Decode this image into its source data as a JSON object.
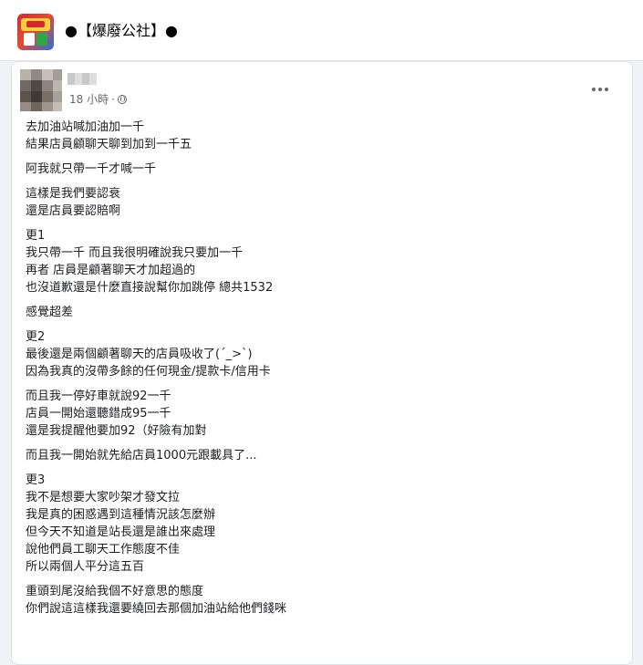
{
  "group": {
    "name": "●【爆廢公社】●"
  },
  "post": {
    "time": "18 小時",
    "separator": "·",
    "paragraphs": [
      [
        "去加油站喊加油加一千",
        "結果店員顧聊天聊到加到一千五"
      ],
      [
        "阿我就只帶一千才喊一千"
      ],
      [
        "這樣是我們要認衰",
        "還是店員要認賠啊"
      ],
      [
        "更1",
        "我只帶一千 而且我很明確說我只要加一千",
        "再者 店員是顧著聊天才加超過的",
        "也沒道歉還是什麼直接說幫你加跳停 總共1532"
      ],
      [
        "感覺超差"
      ],
      [
        "更2",
        "最後還是兩個顧著聊天的店員吸收了(´_>`)",
        "因為我真的沒帶多餘的任何現金/提款卡/信用卡"
      ],
      [
        "而且我一停好車就說92一千",
        "店員一開始還聽錯成95一千",
        "還是我提醒他要加92（好險有加對"
      ],
      [
        "而且我一開始就先給店員1000元跟載具了..."
      ],
      [
        "更3",
        "我不是想要大家吵架才發文拉",
        "我是真的困惑遇到這種情況該怎麼辦",
        "但今天不知道是站長還是誰出來處理",
        "說他們員工聊天工作態度不佳",
        "所以兩個人平分這五百"
      ],
      [
        "重頭到尾沒給我個不好意思的態度",
        "你們說這這樣我還要繞回去那個加油站給他們錢咪"
      ]
    ]
  },
  "icons": {
    "group_logo": "group-logo-icon",
    "privacy": "globe-icon",
    "more": "more-options-icon"
  }
}
